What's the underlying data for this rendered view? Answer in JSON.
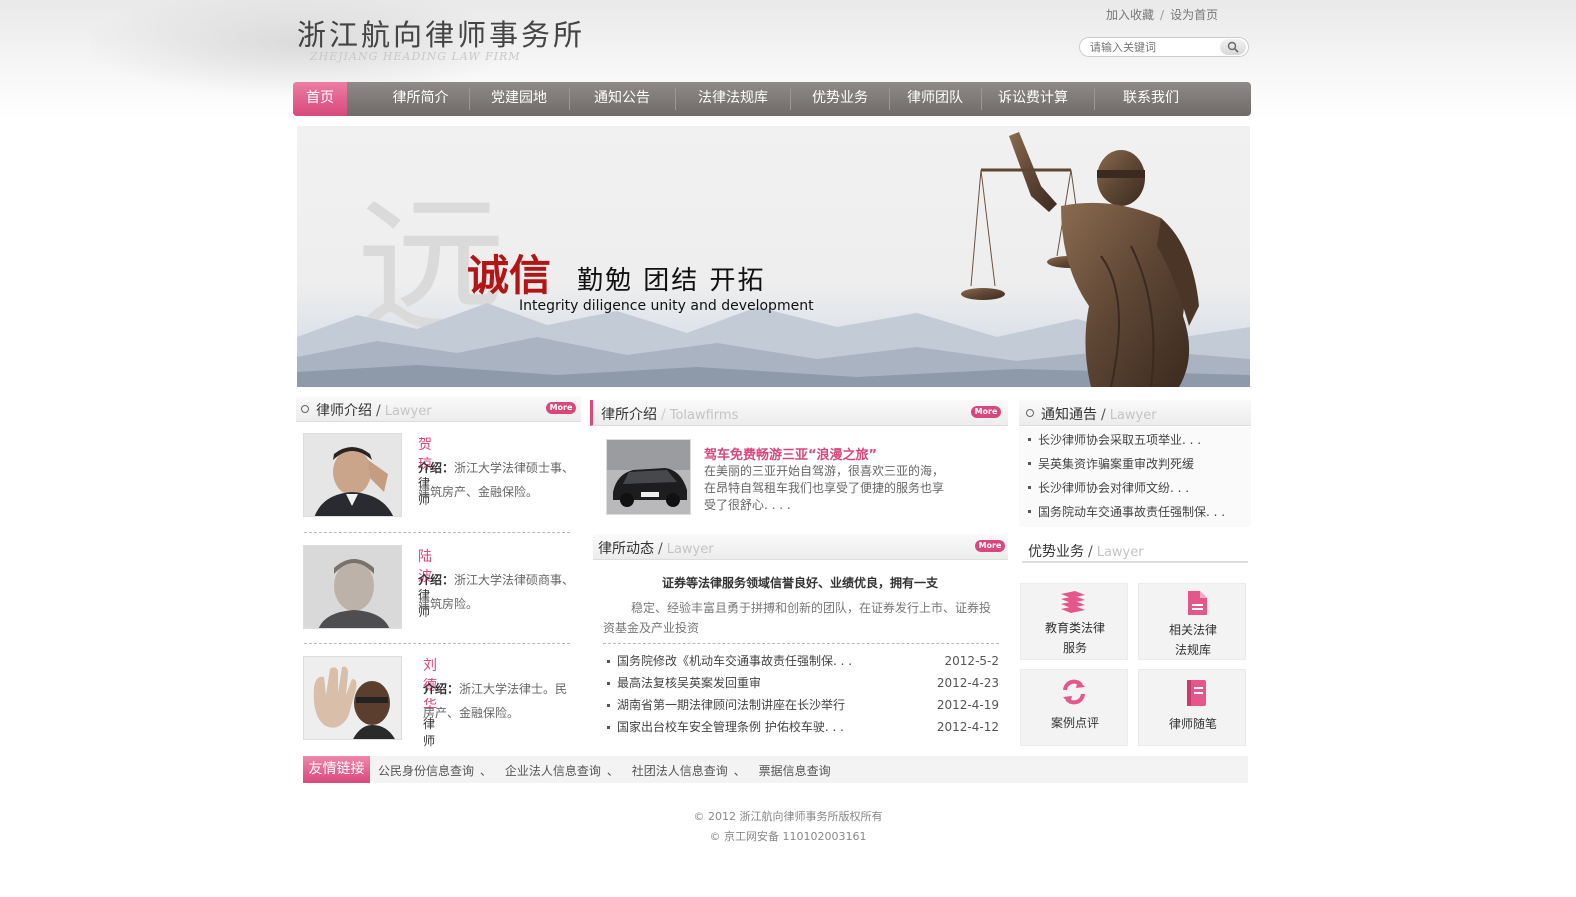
{
  "header": {
    "logo_cn": "浙江航向律师事务所",
    "logo_en": "ZHEJIANG HEADING LAW FIRM",
    "top_links": [
      "加入收藏",
      "设为首页"
    ],
    "top_sep": "/",
    "search_placeholder": "请输入关键词"
  },
  "nav": [
    "首页",
    "律所简介",
    "党建园地",
    "通知公告",
    "法律法规库",
    "优势业务",
    "律师团队",
    "诉讼费计算",
    "联系我们"
  ],
  "banner": {
    "ghost": "远",
    "main": "诚信",
    "sub": "勤勉  团结  开拓",
    "en": "Integrity diligence unity and development"
  },
  "more_label": "More",
  "lawyers_section": {
    "title": "律师介绍",
    "slash": "/",
    "en": "Lawyer",
    "items": [
      {
        "name": "贺琼",
        "title": "律师",
        "intro_label": "介绍：",
        "intro": "浙江大学法律硕士事、建筑房产、金融保险。"
      },
      {
        "name": "陆波",
        "title": "律师",
        "intro_label": "介绍：",
        "intro": "浙江大学法律硕商事、建筑房险。"
      },
      {
        "name": "刘德华",
        "title": "律师",
        "intro_label": "介绍：",
        "intro": "浙江大学法律士。民房产、金融保险。"
      }
    ]
  },
  "firm_intro": {
    "title": "律所介绍",
    "slash": "/",
    "en": "Tolawfirms",
    "news_title": "驾车免费畅游三亚“浪漫之旅”",
    "news_text": "在美丽的三亚开始自驾游，很喜欢三亚的海，在昂特自驾租车我们也享受了便捷的服务也享受了很舒心. . . ."
  },
  "firm_news": {
    "title": "律所动态",
    "slash": "/",
    "en": "Lawyer",
    "headline": "证券等法律服务领域信誉良好、业绩优良，拥有一支",
    "headline_text": "稳定、经验丰富且勇于拼搏和创新的团队，在证券发行上市、证券投资基金及产业投资",
    "items": [
      {
        "text": "国务院修改《机动车交通事故责任强制保. . .",
        "date": "2012-5-2"
      },
      {
        "text": "最高法复核吴英案发回重审",
        "date": "2012-4-23"
      },
      {
        "text": "湖南省第一期法律顾问法制讲座在长沙举行",
        "date": "2012-4-19"
      },
      {
        "text": "国家出台校车安全管理条例 护佑校车驶. . .",
        "date": "2012-4-12"
      }
    ]
  },
  "notices": {
    "title": "通知通告",
    "slash": "/",
    "en": "Lawyer",
    "items": [
      "长沙律师协会采取五项举业. . .",
      "吴英集资诈骗案重审改判死缓",
      "长沙律师协会对律师文纷. . .",
      "国务院动车交通事故责任强制保. . ."
    ]
  },
  "services": {
    "title": "优势业务",
    "slash": "/",
    "en": "Lawyer",
    "items": [
      {
        "line1": "教育类法律",
        "line2": "服务",
        "icon": "books-icon"
      },
      {
        "line1": "相关法律",
        "line2": "法规库",
        "icon": "document-icon"
      },
      {
        "line1": "案例点评",
        "line2": "",
        "icon": "refresh-icon"
      },
      {
        "line1": "律师随笔",
        "line2": "",
        "icon": "notebook-icon"
      }
    ]
  },
  "links": {
    "label": "友情链接",
    "sep": "、",
    "items": [
      "公民身份信息查询",
      "企业法人信息查询",
      "社团法人信息查询",
      "票据信息查询"
    ]
  },
  "footer": {
    "copyright": "© 2012 浙江航向律师事务所版权所有",
    "icp": "© 京工网安备 110102003161"
  },
  "colors": {
    "accent": "#d9487c",
    "nav": "#7d7876",
    "banner_red": "#b21515"
  }
}
